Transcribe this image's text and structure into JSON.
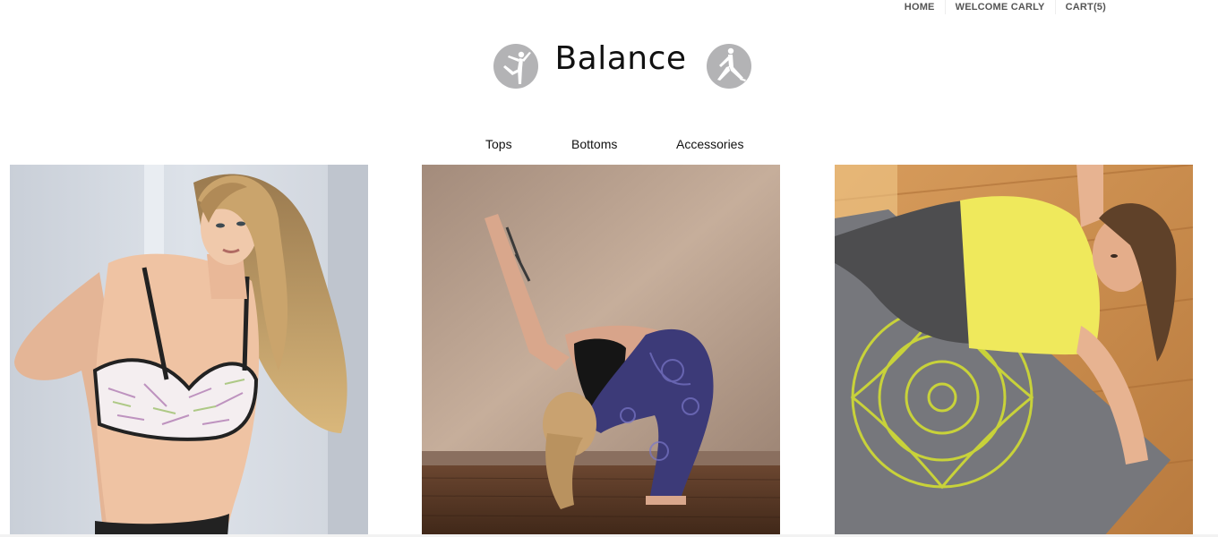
{
  "topnav": {
    "home": "HOME",
    "welcome": "WELCOME CARLY",
    "cart": "CART(5)"
  },
  "brand": {
    "title": "Balance",
    "left_icon": "yoga-dancer-pose-icon",
    "right_icon": "yoga-bridge-pose-icon",
    "icon_color": "#b3b3b5"
  },
  "categories": {
    "tops": "Tops",
    "bottoms": "Bottoms",
    "accessories": "Accessories"
  },
  "products": [
    {
      "image": "woman-in-printed-sports-bra-photo"
    },
    {
      "image": "woman-stretching-in-black-top-and-paisley-leggings-photo"
    },
    {
      "image": "woman-in-yellow-tank-on-yoga-mat-photo"
    }
  ]
}
